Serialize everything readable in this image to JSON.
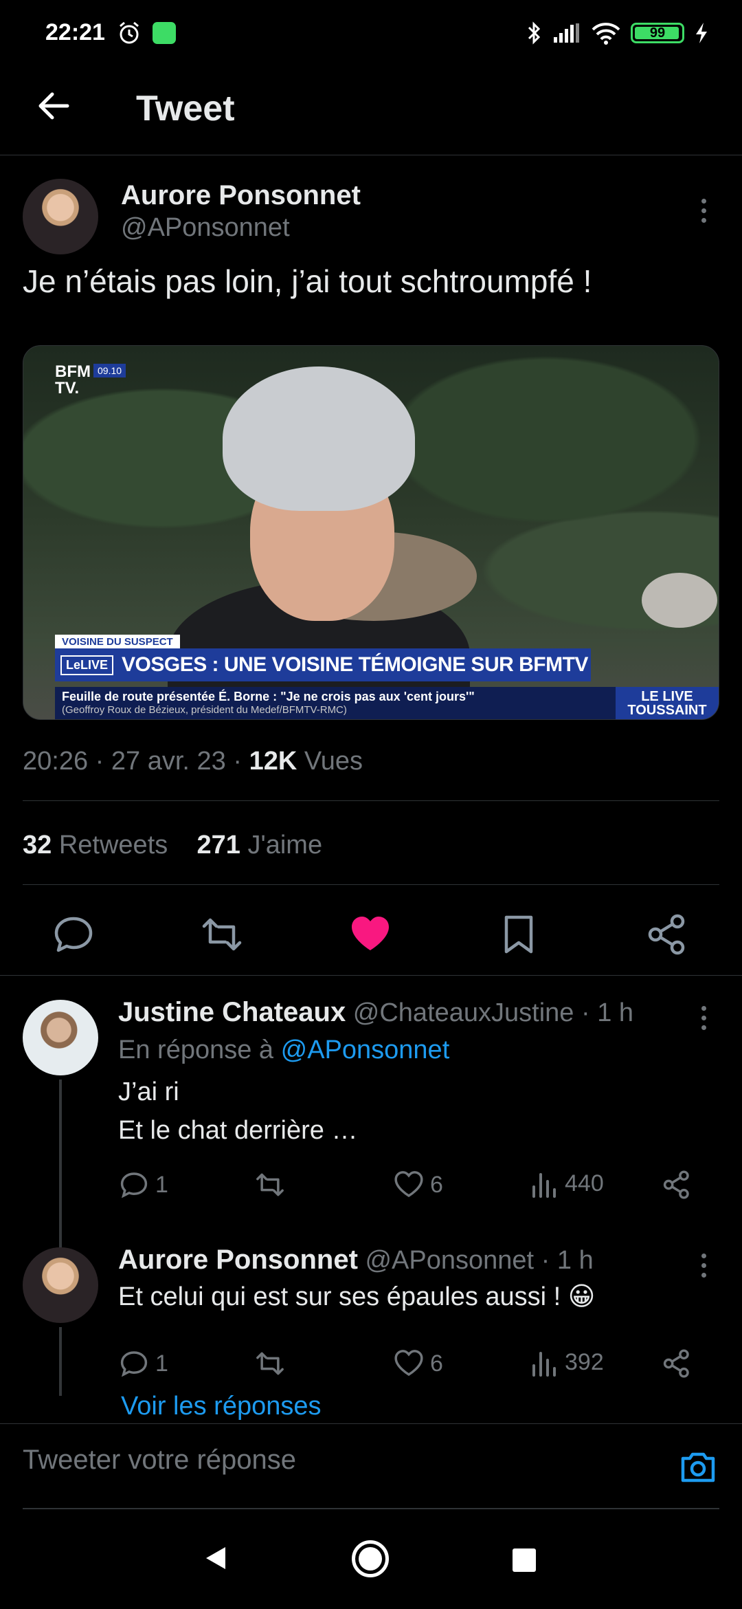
{
  "status_bar": {
    "time": "22:21",
    "battery": "99",
    "icons": [
      "alarm-icon",
      "app-notification-icon",
      "bluetooth-icon",
      "signal-icon",
      "wifi-icon",
      "battery-icon",
      "charging-icon"
    ]
  },
  "header": {
    "back_icon": "arrow-left-icon",
    "title": "Tweet"
  },
  "main_tweet": {
    "author_name": "Aurore Ponsonnet",
    "author_handle": "@APonsonnet",
    "text": "Je n’étais pas loin, j’ai tout schtroumpfé !",
    "media": {
      "channel_logo": "BFM TV.",
      "channel_time": "09.10",
      "lower_tag": "VOISINE DU SUSPECT",
      "live_badge": "LeLIVE",
      "headline": "VOSGES : UNE VOISINE TÉMOIGNE SUR BFMTV",
      "ticker": "Feuille de route présentée É. Borne : \"Je ne crois pas aux 'cent jours'\"",
      "ticker_sub": "(Geoffroy Roux de Bézieux, président du Medef/BFMTV-RMC)",
      "ticker_right": "LE LIVE TOUSSAINT"
    },
    "time": "20:26",
    "date": "27 avr. 23",
    "views_count": "12K",
    "views_label": "Vues",
    "retweets_count": "32",
    "retweets_label": "Retweets",
    "likes_count": "271",
    "likes_label": "J'aime",
    "liked_color": "#f91880"
  },
  "replies": [
    {
      "name": "Justine Chateaux",
      "handle": "@ChateauxJustine",
      "time": "· 1 h",
      "in_reply_prefix": "En réponse à",
      "in_reply_mention": "@APonsonnet",
      "line1": "J’ai ri",
      "line2": "Et le chat derrière …",
      "reply_count": "1",
      "like_count": "6",
      "view_count": "440"
    },
    {
      "name": "Aurore Ponsonnet",
      "handle": "@APonsonnet",
      "time": "· 1 h",
      "line1": "Et celui qui est sur ses épaules aussi ! 😀",
      "reply_count": "1",
      "like_count": "6",
      "view_count": "392"
    }
  ],
  "show_replies": "Voir les réponses",
  "reply_box": {
    "placeholder": "Tweeter votre réponse",
    "camera_icon": "camera-icon"
  },
  "accent_color": "#1d9bf0"
}
